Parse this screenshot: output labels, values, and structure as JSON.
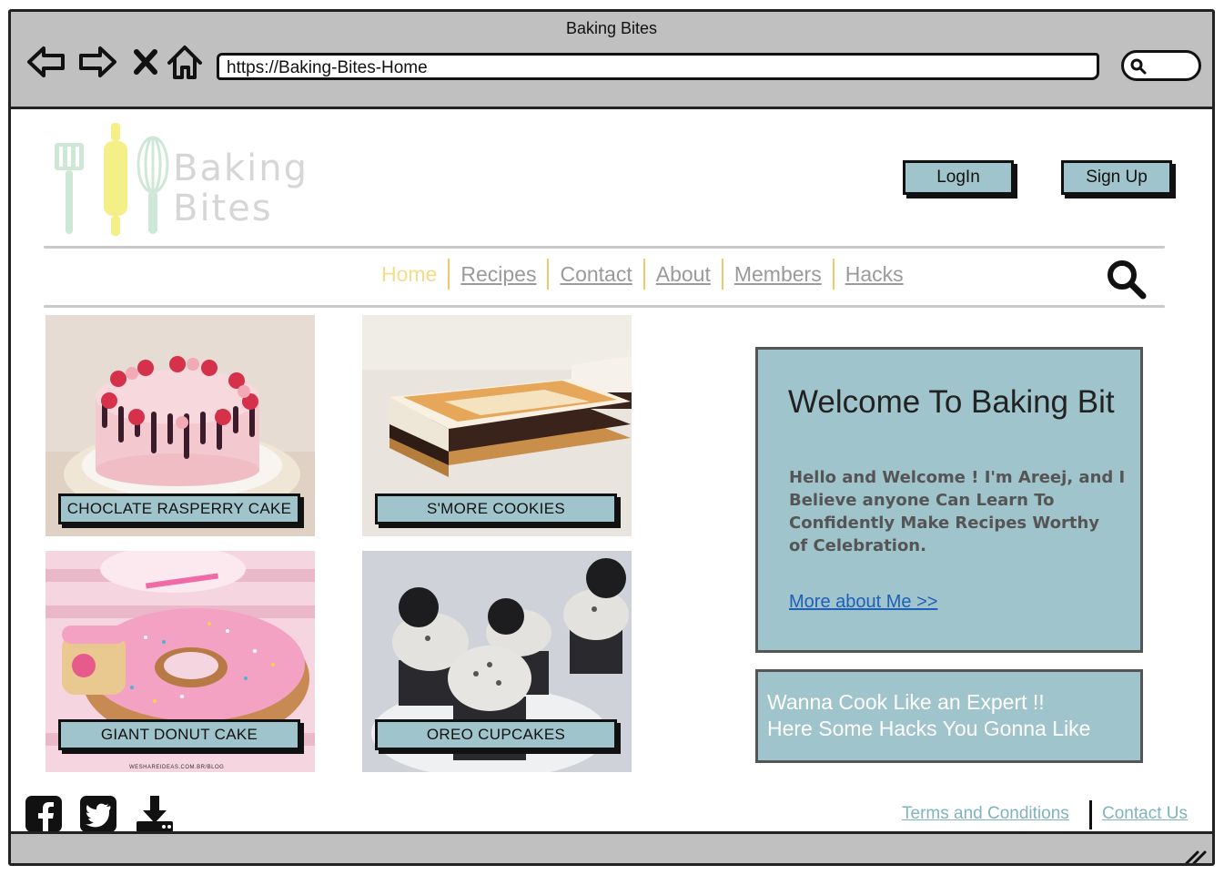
{
  "window": {
    "title": "Baking Bites"
  },
  "browser": {
    "url": "https://Baking-Bites-Home",
    "icons": [
      "back-arrow-icon",
      "forward-arrow-icon",
      "close-x-icon",
      "home-icon",
      "search-icon"
    ]
  },
  "logo": {
    "line1": "Baking",
    "line2": "Bites"
  },
  "auth": {
    "login_label": "LogIn",
    "signup_label": "Sign Up"
  },
  "nav": {
    "items": [
      {
        "label": "Home",
        "active": true
      },
      {
        "label": "Recipes",
        "active": false
      },
      {
        "label": "Contact",
        "active": false
      },
      {
        "label": "About",
        "active": false
      },
      {
        "label": "Members",
        "active": false
      },
      {
        "label": "Hacks",
        "active": false
      }
    ]
  },
  "tiles": [
    {
      "label": "CHOCLATE RASPERRY CAKE"
    },
    {
      "label": "S'MORE COOKIES"
    },
    {
      "label": "GIANT DONUT CAKE",
      "watermark": "WESHAREIDEAS.COM.BR/BLOG"
    },
    {
      "label": "OREO CUPCAKES"
    }
  ],
  "welcome": {
    "title": "Welcome To Baking Bit",
    "body": "Hello and Welcome ! I'm Areej, and I\nBelieve anyone Can  Learn To\nConfidently Make Recipes Worthy\nof Celebration.",
    "link": "More about Me >>"
  },
  "hacks": {
    "text": "Wanna Cook Like an Expert !!\nHere Some Hacks You Gonna Like"
  },
  "footer": {
    "social_icons": [
      "facebook-icon",
      "twitter-icon",
      "download-icon"
    ],
    "terms_label": "Terms and Conditions",
    "contact_label": "Contact Us"
  },
  "colors": {
    "accent": "#a0c4cb",
    "nav_active": "#f4dc88",
    "nav_separator": "#f2c96a",
    "link_blue": "#1f5fb8",
    "footer_link": "#7fb3bd",
    "chrome_gray": "#c0c0c0"
  }
}
